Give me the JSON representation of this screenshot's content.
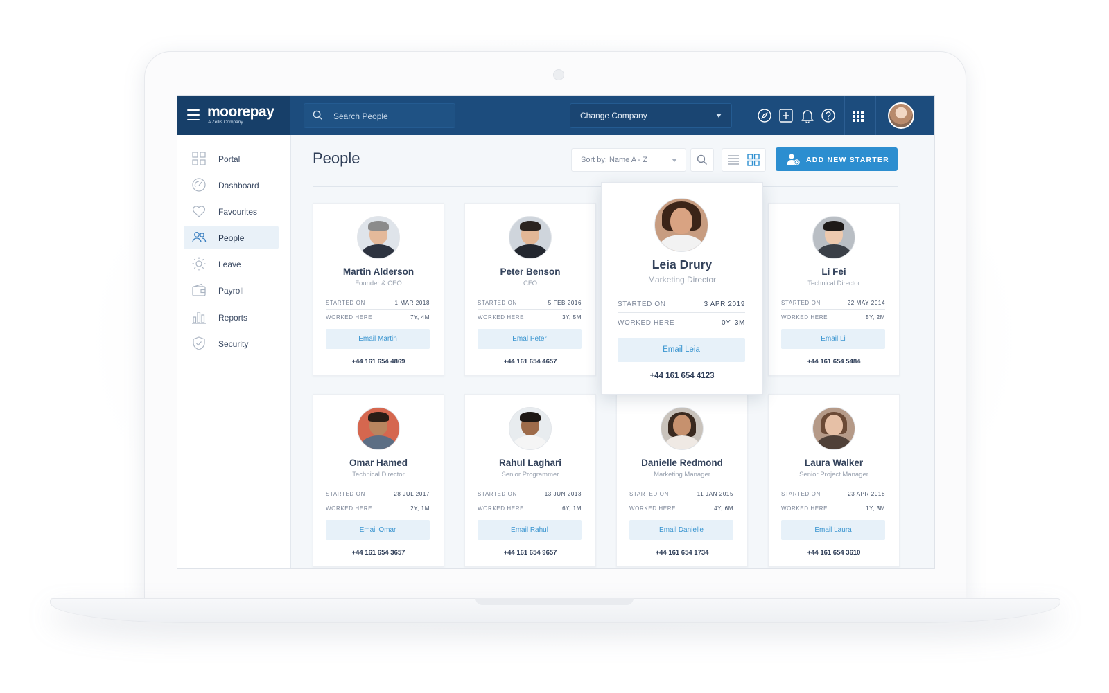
{
  "app": {
    "brand": "moorepay",
    "brand_sub": "A Zellis Company",
    "search_placeholder": "Search People",
    "company_select": "Change Company"
  },
  "sidebar": {
    "items": [
      {
        "label": "Portal",
        "icon": "grid-icon"
      },
      {
        "label": "Dashboard",
        "icon": "gauge-icon"
      },
      {
        "label": "Favourites",
        "icon": "heart-icon"
      },
      {
        "label": "People",
        "icon": "people-icon",
        "active": true
      },
      {
        "label": "Leave",
        "icon": "sun-icon"
      },
      {
        "label": "Payroll",
        "icon": "wallet-icon"
      },
      {
        "label": "Reports",
        "icon": "bar-chart-icon"
      },
      {
        "label": "Security",
        "icon": "shield-icon"
      }
    ]
  },
  "main": {
    "title": "People",
    "sort_label": "Sort by: Name A - Z",
    "add_button": "ADD NEW STARTER"
  },
  "labels": {
    "started_on": "STARTED ON",
    "worked_here": "WORKED HERE"
  },
  "people": [
    {
      "name": "Martin Alderson",
      "role": "Founder & CEO",
      "started": "1 MAR 2018",
      "worked": "7Y, 4M",
      "email_label": "Email Martin",
      "phone": "+44 161 654 4869"
    },
    {
      "name": "Peter Benson",
      "role": "CFO",
      "started": "5 FEB 2016",
      "worked": "3Y, 5M",
      "email_label": "Emal Peter",
      "phone": "+44 161 654 4657"
    },
    {
      "name": "Leia Drury",
      "role": "Marketing Director",
      "started": "3 APR 2019",
      "worked": "0Y, 3M",
      "email_label": "Email Leia",
      "phone": "+44 161 654 4123",
      "featured": true
    },
    {
      "name": "Li Fei",
      "role": "Technical Director",
      "started": "22 MAY 2014",
      "worked": "5Y, 2M",
      "email_label": "Email Li",
      "phone": "+44 161 654 5484"
    },
    {
      "name": "Omar Hamed",
      "role": "Technical Director",
      "started": "28 JUL 2017",
      "worked": "2Y, 1M",
      "email_label": "Email Omar",
      "phone": "+44 161 654 3657"
    },
    {
      "name": "Rahul Laghari",
      "role": "Senior Programmer",
      "started": "13 JUN 2013",
      "worked": "6Y, 1M",
      "email_label": "Email Rahul",
      "phone": "+44 161 654 9657"
    },
    {
      "name": "Danielle Redmond",
      "role": "Marketing Manager",
      "started": "11 JAN 2015",
      "worked": "4Y, 6M",
      "email_label": "Email Danielle",
      "phone": "+44 161 654 1734"
    },
    {
      "name": "Laura Walker",
      "role": "Senior Project Manager",
      "started": "23 APR 2018",
      "worked": "1Y, 3M",
      "email_label": "Email Laura",
      "phone": "+44 161 654 3610"
    }
  ],
  "colors": {
    "topbar": "#1c4c7d",
    "accent": "#2c8ed0",
    "email_bg": "#e7f1f9",
    "active_nav": "#e9f1f8"
  }
}
